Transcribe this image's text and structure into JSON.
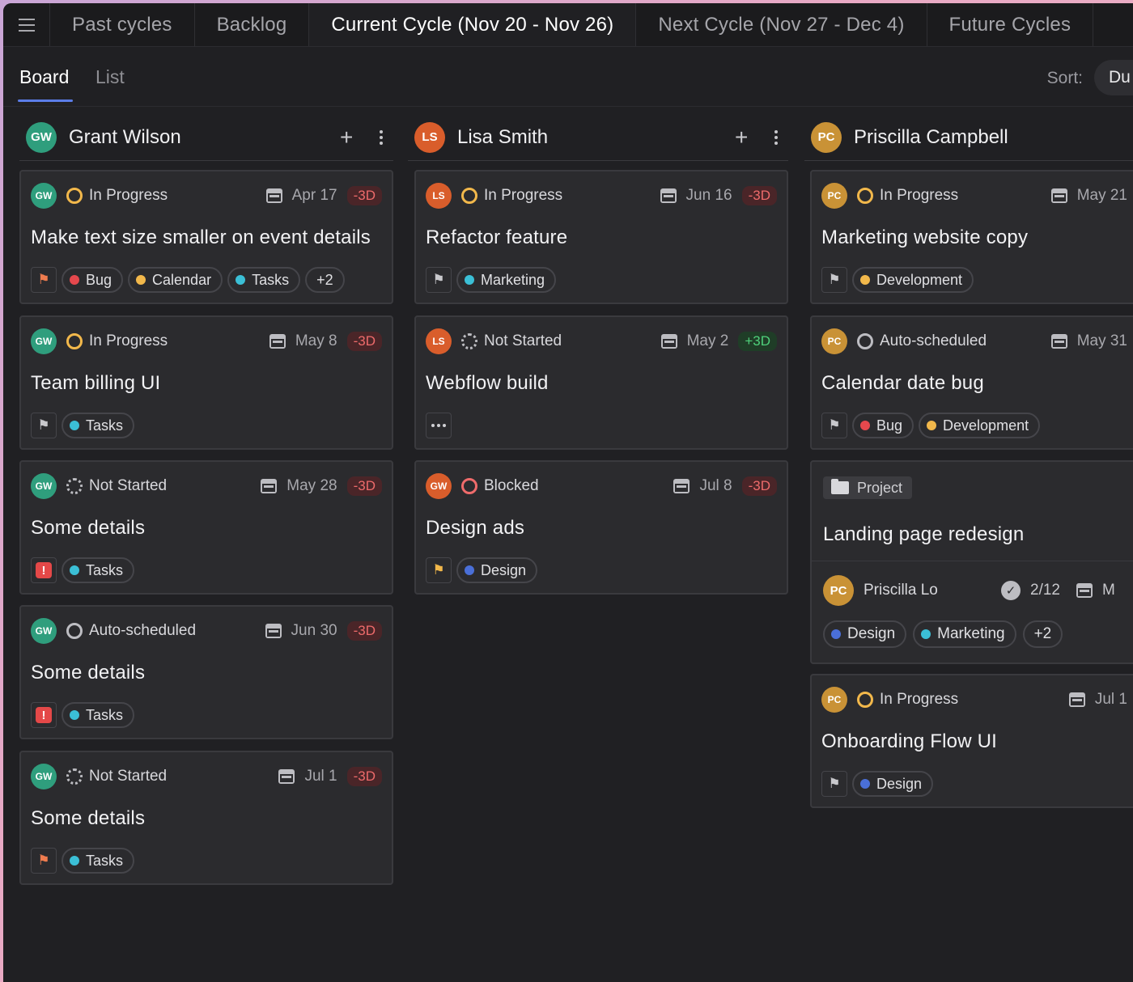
{
  "tabs": [
    {
      "label": "Past cycles",
      "active": false
    },
    {
      "label": "Backlog",
      "active": false
    },
    {
      "label": "Current Cycle (Nov 20 - Nov 26)",
      "active": true
    },
    {
      "label": "Next Cycle (Nov 27 - Dec 4)",
      "active": false
    },
    {
      "label": "Future Cycles",
      "active": false
    }
  ],
  "views": {
    "board": "Board",
    "list": "List"
  },
  "sort": {
    "label": "Sort:",
    "value": "Du"
  },
  "colors": {
    "gw": "#2f9e7d",
    "ls": "#d95d2b",
    "pc": "#c99236",
    "accent": "#5b7de8"
  },
  "columns": [
    {
      "initials": "GW",
      "name": "Grant Wilson",
      "cards": [
        {
          "initials": "GW",
          "status": "In Progress",
          "date": "Apr 17",
          "delta": "-3D",
          "title": "Make text size smaller on event details",
          "tags": [
            {
              "label": "Bug",
              "color": "#e5484d"
            },
            {
              "label": "Calendar",
              "color": "#f2b84b"
            },
            {
              "label": "Tasks",
              "color": "#3bbfd6"
            }
          ],
          "more": "+2"
        },
        {
          "initials": "GW",
          "status": "In Progress",
          "date": "May 8",
          "delta": "-3D",
          "title": "Team billing UI",
          "tags": [
            {
              "label": "Tasks",
              "color": "#3bbfd6"
            }
          ]
        },
        {
          "initials": "GW",
          "status": "Not Started",
          "date": "May 28",
          "delta": "-3D",
          "title": "Some details",
          "tags": [
            {
              "label": "Tasks",
              "color": "#3bbfd6"
            }
          ]
        },
        {
          "initials": "GW",
          "status": "Auto-scheduled",
          "date": "Jun 30",
          "delta": "-3D",
          "title": "Some details",
          "tags": [
            {
              "label": "Tasks",
              "color": "#3bbfd6"
            }
          ]
        },
        {
          "initials": "GW",
          "status": "Not Started",
          "date": "Jul 1",
          "delta": "-3D",
          "title": "Some details",
          "tags": [
            {
              "label": "Tasks",
              "color": "#3bbfd6"
            }
          ]
        }
      ]
    },
    {
      "initials": "LS",
      "name": "Lisa Smith",
      "cards": [
        {
          "initials": "LS",
          "status": "In Progress",
          "date": "Jun 16",
          "delta": "-3D",
          "title": "Refactor feature",
          "tags": [
            {
              "label": "Marketing",
              "color": "#3bbfd6"
            }
          ]
        },
        {
          "initials": "LS",
          "status": "Not Started",
          "date": "May 2",
          "delta": "+3D",
          "title": "Webflow build"
        },
        {
          "initials": "GW",
          "status": "Blocked",
          "date": "Jul 8",
          "delta": "-3D",
          "title": "Design ads",
          "tags": [
            {
              "label": "Design",
              "color": "#4a6fd8"
            }
          ]
        }
      ]
    },
    {
      "initials": "PC",
      "name": "Priscilla Campbell",
      "cards": [
        {
          "initials": "PC",
          "status": "In Progress",
          "date": "May 21",
          "title": "Marketing website copy",
          "tags": [
            {
              "label": "Development",
              "color": "#f2b84b"
            }
          ]
        },
        {
          "initials": "PC",
          "status": "Auto-scheduled",
          "date": "May 31",
          "title": "Calendar date bug",
          "tags": [
            {
              "label": "Bug",
              "color": "#e5484d"
            },
            {
              "label": "Development",
              "color": "#f2b84b"
            }
          ]
        },
        {
          "initials": "PC",
          "status": "In Progress",
          "date": "Jul 1",
          "title": "Onboarding Flow UI",
          "tags": [
            {
              "label": "Design",
              "color": "#4a6fd8"
            }
          ]
        }
      ],
      "project": {
        "chip": "Project",
        "title": "Landing page redesign",
        "owner_initials": "PC",
        "owner": "Priscilla Lo",
        "progress": "2/12",
        "date_partial": "M",
        "tags": [
          {
            "label": "Design",
            "color": "#4a6fd8"
          },
          {
            "label": "Marketing",
            "color": "#3bbfd6"
          }
        ],
        "more": "+2"
      }
    }
  ]
}
